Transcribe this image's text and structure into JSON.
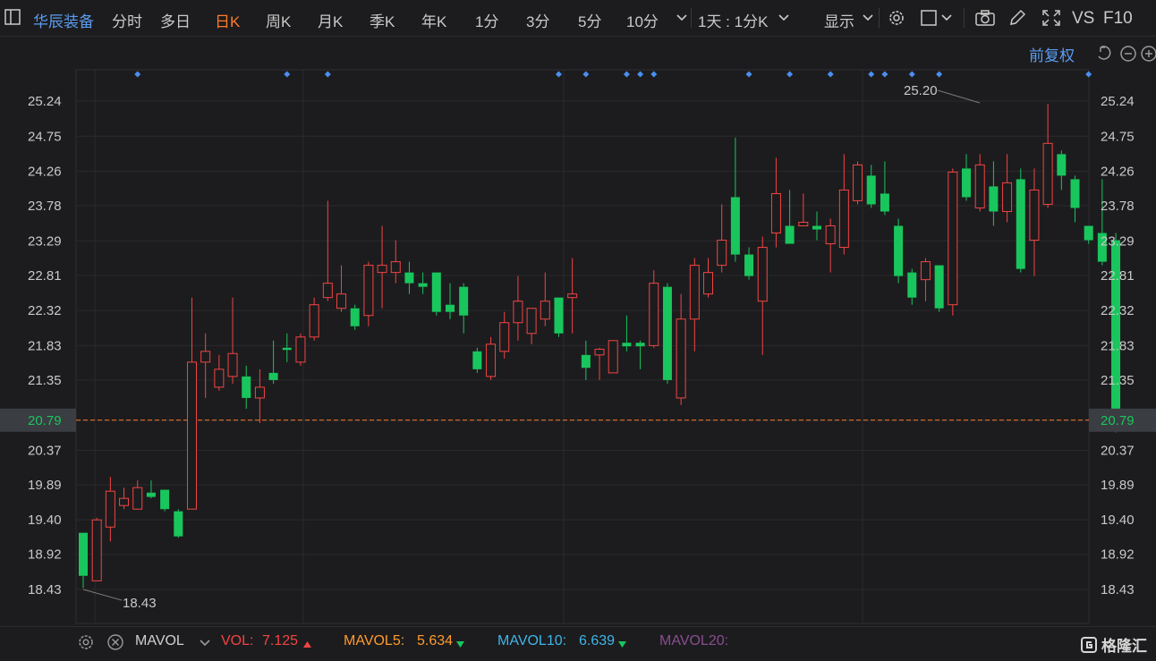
{
  "toolbar": {
    "stock_name": "华辰装备",
    "periods": [
      "分时",
      "多日",
      "日K",
      "周K",
      "月K",
      "季K",
      "年K",
      "1分",
      "3分",
      "5分",
      "10分"
    ],
    "active_period": "日K",
    "range_label": "1天 : 1分K",
    "display_label": "显示",
    "vs_label": "VS",
    "f10_label": "F10"
  },
  "chart": {
    "adjust_label": "前复权",
    "high_label": "25.20",
    "low_label": "18.43",
    "current_price": "20.79",
    "y_ticks": [
      "25.24",
      "24.75",
      "24.26",
      "23.78",
      "23.29",
      "22.81",
      "22.32",
      "21.83",
      "21.35",
      "20.79",
      "20.37",
      "19.89",
      "19.40",
      "18.92",
      "18.43"
    ]
  },
  "chart_data": {
    "type": "candlestick",
    "ylim": [
      18.43,
      25.24
    ],
    "up_color": "#f24444",
    "down_color": "#19c65d",
    "candles": [
      {
        "o": 19.22,
        "c": 18.62,
        "h": 19.22,
        "l": 18.45
      },
      {
        "o": 18.55,
        "c": 19.4,
        "h": 19.43,
        "l": 18.55
      },
      {
        "o": 19.3,
        "c": 19.8,
        "h": 20.0,
        "l": 19.1
      },
      {
        "o": 19.6,
        "c": 19.7,
        "h": 19.85,
        "l": 19.55
      },
      {
        "o": 19.55,
        "c": 19.85,
        "h": 19.95,
        "l": 19.55
      },
      {
        "o": 19.78,
        "c": 19.72,
        "h": 19.95,
        "l": 19.7
      },
      {
        "o": 19.82,
        "c": 19.55,
        "h": 19.82,
        "l": 19.52
      },
      {
        "o": 19.52,
        "c": 19.17,
        "h": 19.55,
        "l": 19.15
      },
      {
        "o": 19.55,
        "c": 21.6,
        "h": 22.5,
        "l": 19.55
      },
      {
        "o": 21.6,
        "c": 21.75,
        "h": 22.0,
        "l": 21.1
      },
      {
        "o": 21.25,
        "c": 21.5,
        "h": 21.7,
        "l": 21.2
      },
      {
        "o": 21.4,
        "c": 21.72,
        "h": 22.5,
        "l": 21.3
      },
      {
        "o": 21.4,
        "c": 21.1,
        "h": 21.55,
        "l": 20.95
      },
      {
        "o": 21.1,
        "c": 21.25,
        "h": 21.5,
        "l": 20.75
      },
      {
        "o": 21.45,
        "c": 21.35,
        "h": 21.9,
        "l": 21.3
      },
      {
        "o": 21.8,
        "c": 21.77,
        "h": 22.0,
        "l": 21.6
      },
      {
        "o": 21.6,
        "c": 21.95,
        "h": 22.0,
        "l": 21.55
      },
      {
        "o": 21.95,
        "c": 22.4,
        "h": 22.5,
        "l": 21.9
      },
      {
        "o": 22.5,
        "c": 22.7,
        "h": 23.85,
        "l": 22.45
      },
      {
        "o": 22.35,
        "c": 22.55,
        "h": 22.95,
        "l": 22.3
      },
      {
        "o": 22.35,
        "c": 22.1,
        "h": 22.4,
        "l": 22.05
      },
      {
        "o": 22.25,
        "c": 22.95,
        "h": 23.0,
        "l": 22.1
      },
      {
        "o": 22.85,
        "c": 22.95,
        "h": 23.5,
        "l": 22.35
      },
      {
        "o": 22.85,
        "c": 23.0,
        "h": 23.3,
        "l": 22.7
      },
      {
        "o": 22.85,
        "c": 22.7,
        "h": 23.0,
        "l": 22.55
      },
      {
        "o": 22.7,
        "c": 22.65,
        "h": 22.85,
        "l": 22.55
      },
      {
        "o": 22.85,
        "c": 22.3,
        "h": 22.85,
        "l": 22.25
      },
      {
        "o": 22.4,
        "c": 22.3,
        "h": 22.7,
        "l": 22.2
      },
      {
        "o": 22.65,
        "c": 22.25,
        "h": 22.7,
        "l": 22.0
      },
      {
        "o": 21.75,
        "c": 21.5,
        "h": 21.8,
        "l": 21.45
      },
      {
        "o": 21.4,
        "c": 21.85,
        "h": 21.95,
        "l": 21.35
      },
      {
        "o": 21.75,
        "c": 22.15,
        "h": 22.3,
        "l": 21.65
      },
      {
        "o": 22.15,
        "c": 22.45,
        "h": 22.8,
        "l": 21.9
      },
      {
        "o": 22.0,
        "c": 22.35,
        "h": 22.35,
        "l": 21.85
      },
      {
        "o": 22.2,
        "c": 22.45,
        "h": 22.85,
        "l": 22.1
      },
      {
        "o": 22.5,
        "c": 22.0,
        "h": 22.5,
        "l": 21.95
      },
      {
        "o": 22.5,
        "c": 22.55,
        "h": 23.05,
        "l": 22.0
      },
      {
        "o": 21.7,
        "c": 21.52,
        "h": 21.9,
        "l": 21.35
      },
      {
        "o": 21.7,
        "c": 21.78,
        "h": 21.8,
        "l": 21.35
      },
      {
        "o": 21.45,
        "c": 21.9,
        "h": 21.9,
        "l": 21.45
      },
      {
        "o": 21.87,
        "c": 21.82,
        "h": 22.25,
        "l": 21.75
      },
      {
        "o": 21.87,
        "c": 21.82,
        "h": 21.9,
        "l": 21.5
      },
      {
        "o": 21.83,
        "c": 22.7,
        "h": 22.88,
        "l": 21.8
      },
      {
        "o": 22.65,
        "c": 21.35,
        "h": 22.7,
        "l": 21.3
      },
      {
        "o": 21.1,
        "c": 22.2,
        "h": 22.55,
        "l": 21.0
      },
      {
        "o": 22.2,
        "c": 22.95,
        "h": 23.05,
        "l": 21.75
      },
      {
        "o": 22.55,
        "c": 22.85,
        "h": 23.05,
        "l": 22.5
      },
      {
        "o": 22.95,
        "c": 23.3,
        "h": 23.8,
        "l": 22.85
      },
      {
        "o": 23.9,
        "c": 23.1,
        "h": 24.73,
        "l": 23.0
      },
      {
        "o": 23.1,
        "c": 22.8,
        "h": 23.2,
        "l": 22.75
      },
      {
        "o": 22.45,
        "c": 23.2,
        "h": 23.35,
        "l": 21.7
      },
      {
        "o": 23.4,
        "c": 23.95,
        "h": 24.45,
        "l": 23.2
      },
      {
        "o": 23.5,
        "c": 23.25,
        "h": 24.0,
        "l": 23.25
      },
      {
        "o": 23.5,
        "c": 23.55,
        "h": 23.95,
        "l": 23.5
      },
      {
        "o": 23.5,
        "c": 23.45,
        "h": 23.7,
        "l": 23.3
      },
      {
        "o": 23.25,
        "c": 23.5,
        "h": 23.6,
        "l": 22.85
      },
      {
        "o": 23.2,
        "c": 24.0,
        "h": 24.5,
        "l": 23.1
      },
      {
        "o": 23.85,
        "c": 24.35,
        "h": 24.4,
        "l": 23.8
      },
      {
        "o": 24.2,
        "c": 23.8,
        "h": 24.35,
        "l": 23.75
      },
      {
        "o": 23.95,
        "c": 23.7,
        "h": 24.4,
        "l": 23.65
      },
      {
        "o": 23.5,
        "c": 22.8,
        "h": 23.6,
        "l": 22.7
      },
      {
        "o": 22.85,
        "c": 22.5,
        "h": 22.9,
        "l": 22.4
      },
      {
        "o": 22.75,
        "c": 23.0,
        "h": 23.05,
        "l": 22.45
      },
      {
        "o": 22.95,
        "c": 22.35,
        "h": 22.95,
        "l": 22.3
      },
      {
        "o": 22.4,
        "c": 24.25,
        "h": 24.3,
        "l": 22.25
      },
      {
        "o": 24.3,
        "c": 23.9,
        "h": 24.5,
        "l": 23.85
      },
      {
        "o": 23.75,
        "c": 24.35,
        "h": 24.5,
        "l": 23.7
      },
      {
        "o": 24.05,
        "c": 23.7,
        "h": 24.4,
        "l": 23.5
      },
      {
        "o": 23.7,
        "c": 24.1,
        "h": 24.5,
        "l": 23.55
      },
      {
        "o": 24.15,
        "c": 22.9,
        "h": 24.3,
        "l": 22.85
      },
      {
        "o": 23.3,
        "c": 24.0,
        "h": 24.3,
        "l": 22.8
      },
      {
        "o": 23.8,
        "c": 24.65,
        "h": 25.2,
        "l": 23.75
      },
      {
        "o": 24.5,
        "c": 24.2,
        "h": 24.55,
        "l": 24.0
      },
      {
        "o": 24.15,
        "c": 23.75,
        "h": 24.2,
        "l": 23.55
      },
      {
        "o": 23.5,
        "c": 23.3,
        "h": 23.5,
        "l": 23.25
      },
      {
        "o": 23.4,
        "c": 23.0,
        "h": 24.15,
        "l": 22.95
      },
      {
        "o": 23.3,
        "c": 20.79,
        "h": 23.4,
        "l": 20.62
      }
    ],
    "markers": [
      4,
      15,
      18,
      35,
      37,
      40,
      41,
      42,
      49,
      52,
      55,
      58,
      59,
      61,
      63,
      74
    ]
  },
  "volume_bar": {
    "label": "MAVOL",
    "vol_label": "VOL:",
    "vol_value": "7.125",
    "mavol5_label": "MAVOL5:",
    "mavol5_value": "5.634",
    "mavol10_label": "MAVOL10:",
    "mavol10_value": "6.639",
    "mavol20_label": "MAVOL20:",
    "colors": {
      "vol": "#f24444",
      "mavol5": "#ff9a2e",
      "mavol10": "#3fb5ea",
      "mavol20": "#8a4d8f"
    }
  },
  "watermark": "格隆汇"
}
